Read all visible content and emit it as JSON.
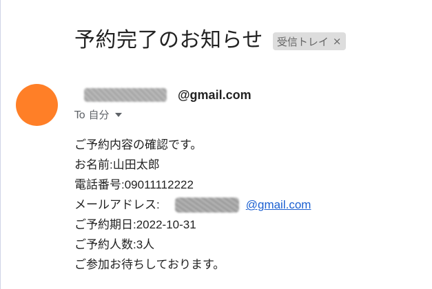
{
  "email": {
    "subject": "予約完了のお知らせ",
    "label": {
      "name": "受信トレイ",
      "close": "×"
    },
    "sender": {
      "domain": "@gmail.com"
    },
    "recipient": {
      "label": "To 自分"
    },
    "body": {
      "line1": "ご予約内容の確認です。",
      "line2": "お名前:山田太郎",
      "line3": "電話番号:09011112222",
      "line4_label": "メールアドレス:",
      "line4_domain": "@gmail.com",
      "line5": "ご予約期日:2022-10-31",
      "line6": "ご予約人数:3人",
      "line7": "ご参加お待ちしております。"
    }
  },
  "colors": {
    "avatar": "#ff7f27",
    "link": "#1a5fd1",
    "chip_background": "#dddddd"
  },
  "icons": {
    "chip_close": "close-icon",
    "recipient_toggle": "chevron-down-icon"
  }
}
